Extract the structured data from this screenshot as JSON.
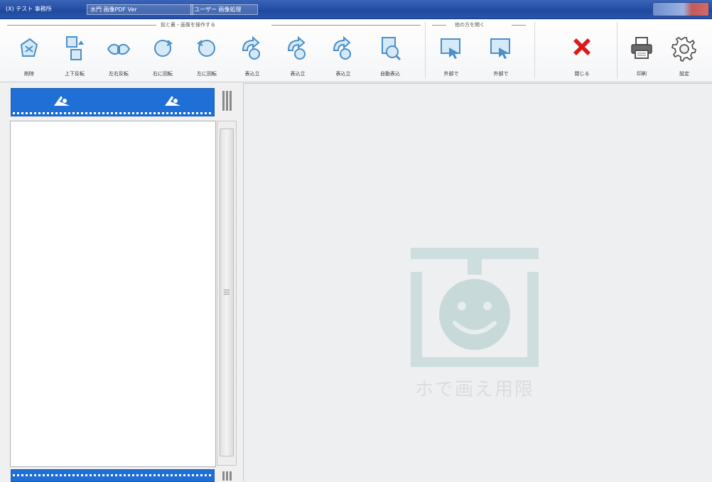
{
  "window": {
    "title_segments": [
      "(X) テスト 事務所",
      "水門 画像PDF Ver",
      "ユーザー 画像処理"
    ]
  },
  "toolbar": {
    "group_edit_caption": "前と裏・画像を操作する",
    "group_open_caption": "他の方を開く",
    "tools": [
      {
        "id": "delete",
        "label": "削除"
      },
      {
        "id": "flip-vertical",
        "label": "上下反転"
      },
      {
        "id": "flip-horizontal",
        "label": "左右反転"
      },
      {
        "id": "rotate-right",
        "label": "右に回転"
      },
      {
        "id": "rotate-left",
        "label": "左に回転"
      },
      {
        "id": "merge-1",
        "label": "表込立"
      },
      {
        "id": "merge-2",
        "label": "表込立"
      },
      {
        "id": "merge-3",
        "label": "表込立"
      },
      {
        "id": "auto-merge",
        "label": "自動表込"
      }
    ],
    "open_tools": [
      {
        "id": "open-external-1",
        "label": "外部で"
      },
      {
        "id": "open-external-2",
        "label": "外部で"
      }
    ],
    "close_label": "閉じる",
    "print_label": "印刷",
    "settings_label": "設定"
  },
  "viewer": {
    "watermark_caption": "ホで画え用限"
  },
  "colors": {
    "titlebar": "#1f4aa0",
    "film": "#1f6fd6",
    "icon_blue": "#4a8fc9",
    "close_red": "#d91a1a",
    "watermark": "#c9dcdc"
  }
}
